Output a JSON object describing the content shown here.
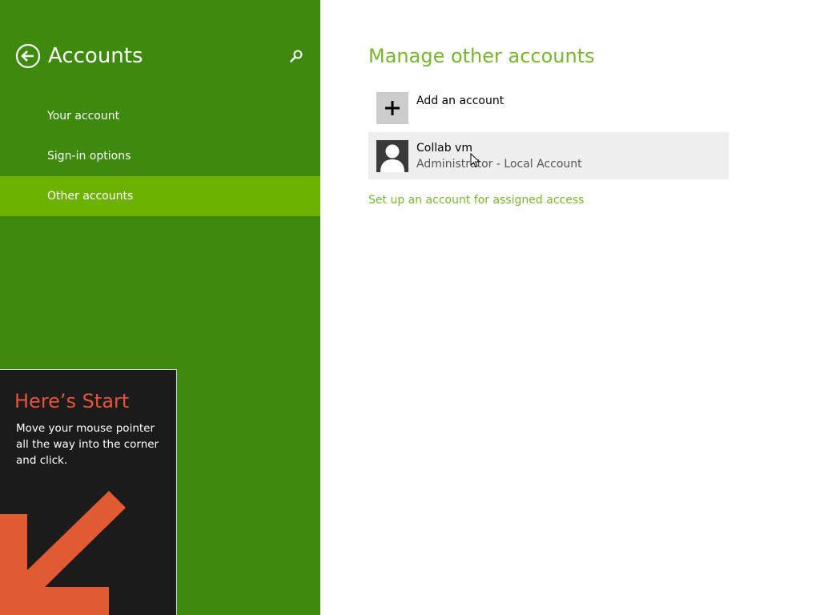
{
  "nav": {
    "title": "Accounts",
    "items": [
      {
        "label": "Your account",
        "selected": false
      },
      {
        "label": "Sign-in options",
        "selected": false
      },
      {
        "label": "Other accounts",
        "selected": true
      }
    ],
    "icons": {
      "back": "back-arrow-icon",
      "search": "search-icon"
    }
  },
  "main": {
    "title": "Manage other accounts",
    "add_account_label": "Add an account",
    "account": {
      "name": "Collab vm",
      "type": "Administrator - Local Account"
    },
    "assigned_access_link": "Set up an account for assigned access"
  },
  "start_tip": {
    "title": "Here’s Start",
    "body": "Move your mouse pointer all the way into the corner and click."
  },
  "colors": {
    "nav_background": "#3d8a0f",
    "nav_selected": "#6db200",
    "accent_green": "#76b72b",
    "tip_background": "#1b1b1b",
    "tip_accent": "#e8533a"
  }
}
